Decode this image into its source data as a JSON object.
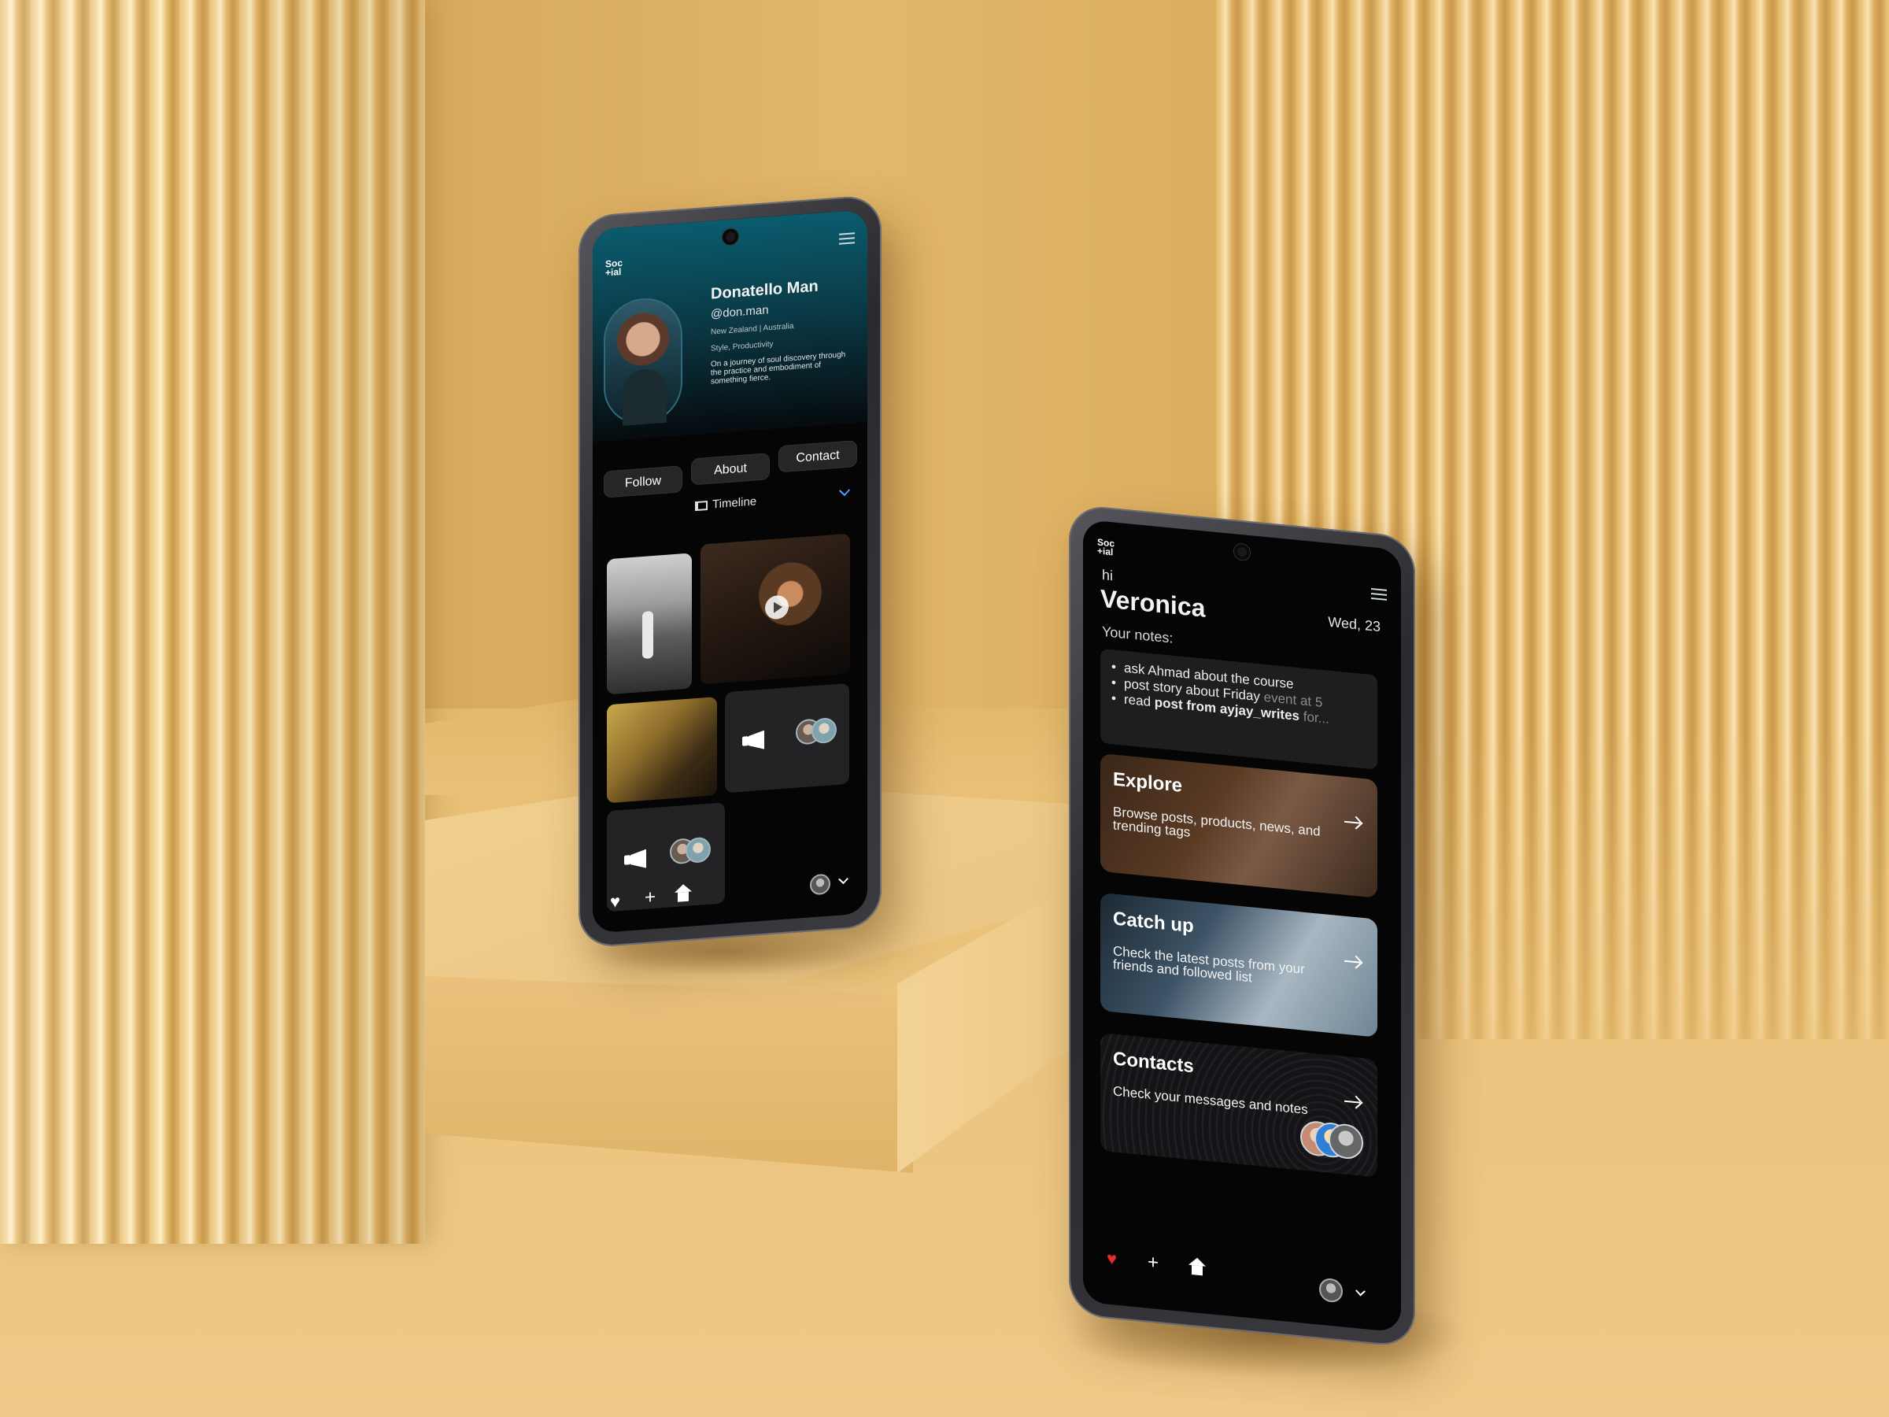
{
  "profile_screen": {
    "logo": "Soc\n+ial",
    "name": "Donatello Man",
    "handle": "@don.man",
    "location": "New Zealand | Australia",
    "tags": "Style, Productivity",
    "bio": "On a journey of soul discovery through the practice and embodiment of something fierce.",
    "buttons": {
      "follow": "Follow",
      "about": "About",
      "contact": "Contact"
    },
    "view_selector": "Timeline",
    "nav_icons": [
      "heart-icon",
      "plus-icon",
      "home-icon",
      "avatar",
      "chevron-down-icon"
    ]
  },
  "home_screen": {
    "logo": "Soc\n+ial",
    "greeting": "hi",
    "user_name": "Veronica",
    "date": "Wed, 23",
    "notes_label": "Your notes:",
    "notes": [
      {
        "text": "ask Ahmad about the course"
      },
      {
        "text": "post story about Friday ",
        "faded": "event at 5"
      },
      {
        "prefix": "read ",
        "bold": "post from ayjay_writes",
        "faded": " for..."
      }
    ],
    "cards": [
      {
        "title": "Explore",
        "description": "Browse posts, products, news, and trending tags"
      },
      {
        "title": "Catch up",
        "description": "Check the latest posts from your friends and followed list"
      },
      {
        "title": "Contacts",
        "description": "Check your messages and notes"
      }
    ],
    "colors": {
      "accent_heart": "#e22b2b",
      "timeline_chevron": "#4aa3ff"
    }
  }
}
